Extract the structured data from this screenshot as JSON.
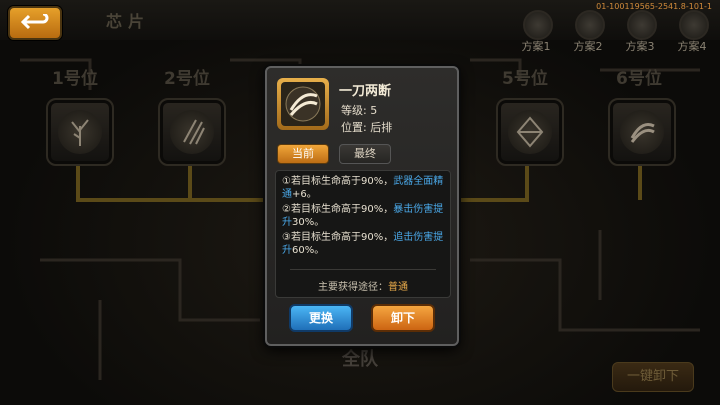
{
  "header": {
    "title": "芯片",
    "id_text": "01-100119565-2541.8-101-1"
  },
  "plans": [
    {
      "label": "方案1"
    },
    {
      "label": "方案2"
    },
    {
      "label": "方案3"
    },
    {
      "label": "方案4"
    }
  ],
  "slots": [
    {
      "label": "1号位",
      "icon": "tree-icon"
    },
    {
      "label": "2号位",
      "icon": "claw-icon"
    },
    {
      "label": "5号位",
      "icon": "shield-icon"
    },
    {
      "label": "6号位",
      "icon": "slash-icon"
    }
  ],
  "team_label": "全队",
  "unload_all_label": "一键卸下",
  "dialog": {
    "name": "一刀两断",
    "level_label": "等级:",
    "level_value": "5",
    "position_label": "位置:",
    "position_value": "后排",
    "tabs": [
      "当前",
      "最终"
    ],
    "effects": [
      {
        "prefix": "①若目标生命高于90%，",
        "highlight": "武器全面精通",
        "suffix": "+6。"
      },
      {
        "prefix": "②若目标生命高于90%，",
        "highlight": "暴击伤害提升",
        "suffix": "30%。"
      },
      {
        "prefix": "③若目标生命高于90%，",
        "highlight": "追击伤害提升",
        "suffix": "60%。"
      }
    ],
    "source_label": "主要获得途径：",
    "source_value": "普通",
    "replace_label": "更换",
    "unload_label": "卸下"
  },
  "colors": {
    "accent_orange": "#e89a2a",
    "highlight_blue": "#4aa8e8",
    "button_blue": "#2f8fd8"
  }
}
